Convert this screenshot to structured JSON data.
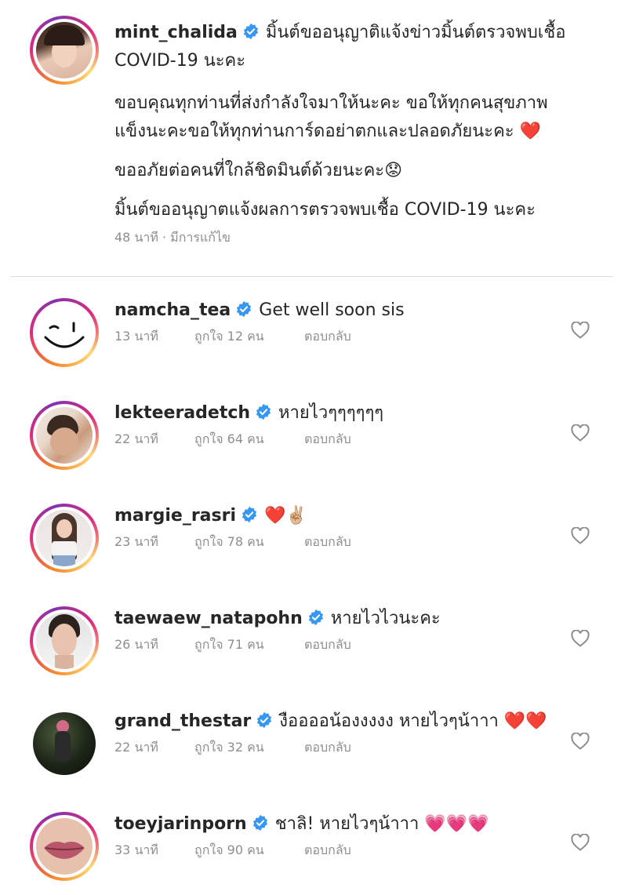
{
  "caption": {
    "username": "mint_chalida",
    "line1": "มิ้นต์ขออนุญาติแจ้งข่าวมิ้นต์ตรวจพบเชื้อ",
    "line2": "COVID-19 นะคะ",
    "line3": "ขอบคุณทุกท่านที่ส่งกำลังใจมาให้นะคะ ขอให้ทุกคนสุขภาพ",
    "line4": "แข็งนะคะขอให้ทุกท่านการ์ดอย่าตกและปลอดภัยนะคะ",
    "line4_emoji": "❤️",
    "line5": "ขออภัยต่อคนที่ใกล้ชิดมินต์ด้วยนะคะ",
    "line5_emoji": "😟",
    "line6": "มิ้นต์ขออนุญาตแจ้งผลการตรวจพบเชื้อ COVID-19 นะคะ",
    "meta": "48 นาที · มีการแก้ไข"
  },
  "comments": [
    {
      "username": "namcha_tea",
      "text": "Get well soon sis",
      "emoji": "",
      "time": "13 นาที",
      "likes": "ถูกใจ 12 คน",
      "reply": "ตอบกลับ",
      "avatar": "smiley-avatar"
    },
    {
      "username": "lekteeradetch",
      "text": "หายไวๆๆๆๆๆๆ",
      "emoji": "",
      "time": "22 นาที",
      "likes": "ถูกใจ 64 คน",
      "reply": "ตอบกลับ",
      "avatar": "photo-avatar"
    },
    {
      "username": "margie_rasri",
      "text": "",
      "emoji": "❤️✌🏼",
      "time": "23 นาที",
      "likes": "ถูกใจ 78 คน",
      "reply": "ตอบกลับ",
      "avatar": "photo-avatar"
    },
    {
      "username": "taewaew_natapohn",
      "text": "หายไวไวนะคะ",
      "emoji": "",
      "time": "26 นาที",
      "likes": "ถูกใจ 71 คน",
      "reply": "ตอบกลับ",
      "avatar": "photo-avatar"
    },
    {
      "username": "grand_thestar",
      "text": "งืออออน้องงงงง หายไวๆน้าาา",
      "emoji": "❤️❤️",
      "time": "22 นาที",
      "likes": "ถูกใจ 32 คน",
      "reply": "ตอบกลับ",
      "avatar": "photo-avatar"
    },
    {
      "username": "toeyjarinporn",
      "text": "ชาลิ! หายไวๆน้าาา",
      "emoji": "💗💗💗",
      "time": "33 นาที",
      "likes": "ถูกใจ 90 คน",
      "reply": "ตอบกลับ",
      "avatar": "lips-avatar"
    }
  ],
  "colors": {
    "verified": "#3897f0",
    "meta": "#8e8e8e",
    "heart_emoji": "#e0245e"
  }
}
